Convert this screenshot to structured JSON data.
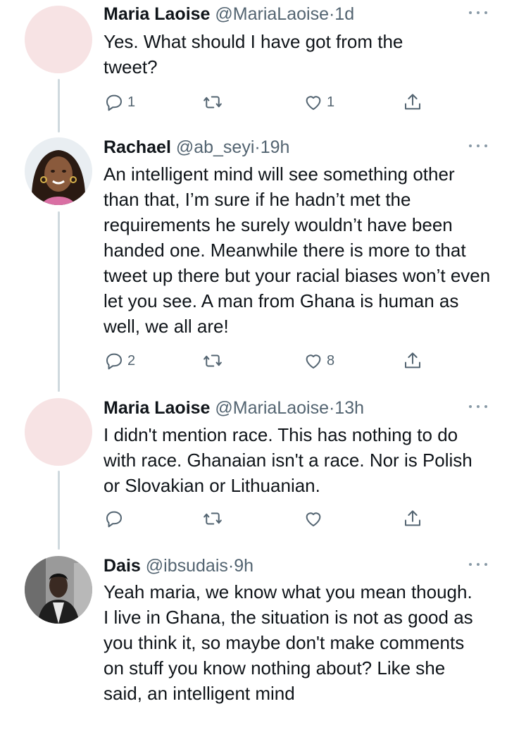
{
  "tweets": [
    {
      "name": "Maria Laoise",
      "handle": "@MariaLaoise",
      "separator": "·",
      "time": "1d",
      "body": "Yes. What should I have got from the tweet?",
      "reply_count": "1",
      "retweet_count": "",
      "like_count": "1"
    },
    {
      "name": "Rachael",
      "handle": "@ab_seyi",
      "separator": "·",
      "time": "19h",
      "body": "An intelligent mind will see something other than that, I’m sure if he hadn’t met the requirements he surely wouldn’t have been handed one. Meanwhile there is more to that tweet up there but your racial biases won’t even let you see. A man from Ghana is human as well, we all are!",
      "reply_count": "2",
      "retweet_count": "",
      "like_count": "8"
    },
    {
      "name": "Maria Laoise",
      "handle": "@MariaLaoise",
      "separator": "·",
      "time": "13h",
      "body": "I didn't mention race. This has nothing to do with race. Ghanaian isn't a race. Nor is Polish or Slovakian or Lithuanian.",
      "reply_count": "",
      "retweet_count": "",
      "like_count": ""
    },
    {
      "name": "Dais",
      "handle": "@ibsudais",
      "separator": "·",
      "time": "9h",
      "body": "Yeah maria, we know what you mean though.\nI live in Ghana, the situation is not as good as you think it, so maybe don't make comments on stuff you know nothing about? Like she said, an intelligent mind",
      "reply_count": "",
      "retweet_count": "",
      "like_count": ""
    }
  ],
  "colors": {
    "text": "#0f1419",
    "secondary": "#536471",
    "thread_line": "#cfd9de",
    "blank_avatar": "#f7e3e4"
  },
  "icons": [
    "reply-icon",
    "retweet-icon",
    "like-icon",
    "share-icon",
    "more-icon"
  ]
}
